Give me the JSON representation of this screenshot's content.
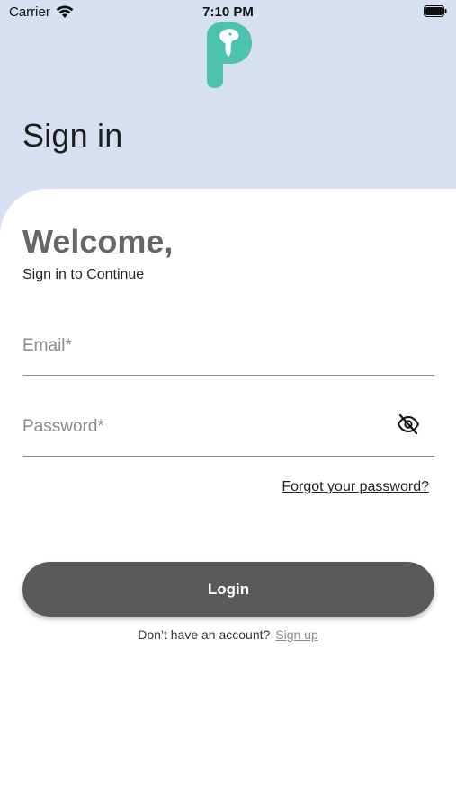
{
  "status_bar": {
    "carrier": "Carrier",
    "time": "7:10 PM"
  },
  "header": {
    "title": "Sign in"
  },
  "card": {
    "welcome": "Welcome,",
    "subtitle": "Sign in to Continue"
  },
  "form": {
    "email_placeholder": "Email*",
    "password_placeholder": "Password*",
    "forgot_label": "Forgot your password?",
    "login_label": "Login"
  },
  "footer": {
    "question": "Don’t have an account?",
    "signup_label": "Sign up"
  },
  "colors": {
    "header_bg": "#d6e0f2",
    "logo_teal": "#4cc2b0",
    "button_bg": "#5a5a5a"
  },
  "icons": {
    "wifi": "wifi-icon",
    "battery": "battery-icon",
    "logo": "app-logo-icon",
    "visibility_toggle": "eye-off-icon"
  }
}
